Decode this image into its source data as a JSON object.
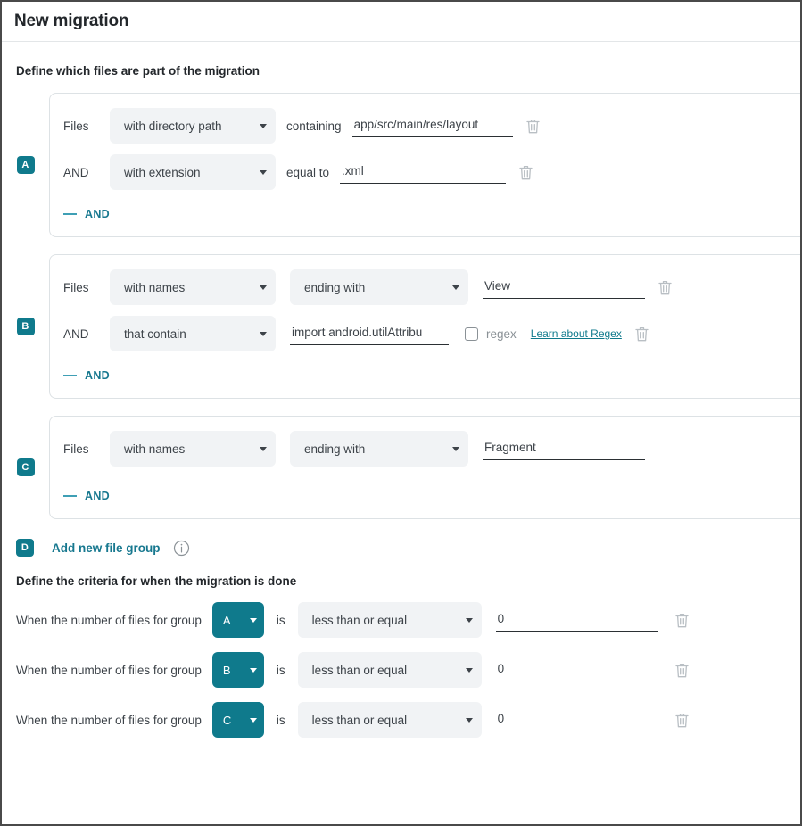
{
  "window": {
    "title": "New migration"
  },
  "colors": {
    "teal": "#0f7a8c",
    "link": "#17788f",
    "select_bg": "#f1f3f5",
    "border": "#dde2e5",
    "text": "#3d4349"
  },
  "sections": {
    "files_heading": "Define which files are part of the migration",
    "criteria_heading": "Define the criteria for when the migration is done"
  },
  "labels": {
    "files": "Files",
    "and": "AND",
    "add_and": "AND",
    "containing": "containing",
    "equal_to": "equal to",
    "regex": "regex",
    "regex_link": "Learn about Regex",
    "is": "is",
    "when_prefix": "When the number of files for group",
    "add_group": "Add new file group"
  },
  "icons": {
    "trash": "trash-icon",
    "info": "info-icon",
    "plus": "plus-icon",
    "caret": "chevron-down-icon",
    "checkbox": "checkbox-unchecked-icon"
  },
  "groups": [
    {
      "badge": "A",
      "conditions": [
        {
          "prefix": "Files",
          "type": "with directory path",
          "mid_label": "containing",
          "value": "app/src/main/res/layout",
          "has_operator_select": false,
          "has_regex": false
        },
        {
          "prefix": "AND",
          "type": "with extension",
          "mid_label": "equal to",
          "value": ".xml",
          "has_operator_select": false,
          "has_regex": false
        }
      ]
    },
    {
      "badge": "B",
      "conditions": [
        {
          "prefix": "Files",
          "type": "with names",
          "operator": "ending with",
          "value": "View",
          "has_operator_select": true,
          "has_regex": false
        },
        {
          "prefix": "AND",
          "type": "that contain",
          "value": "import android.utilAttribu",
          "has_operator_select": false,
          "has_regex": true,
          "regex_checked": false
        }
      ]
    },
    {
      "badge": "C",
      "conditions": [
        {
          "prefix": "Files",
          "type": "with names",
          "operator": "ending with",
          "value": "Fragment",
          "has_operator_select": true,
          "has_regex": false
        }
      ]
    }
  ],
  "add_group_badge": "D",
  "criteria": [
    {
      "group": "A",
      "comparator": "less than or equal",
      "value": "0"
    },
    {
      "group": "B",
      "comparator": "less than or equal",
      "value": "0"
    },
    {
      "group": "C",
      "comparator": "less than or equal",
      "value": "0"
    }
  ]
}
